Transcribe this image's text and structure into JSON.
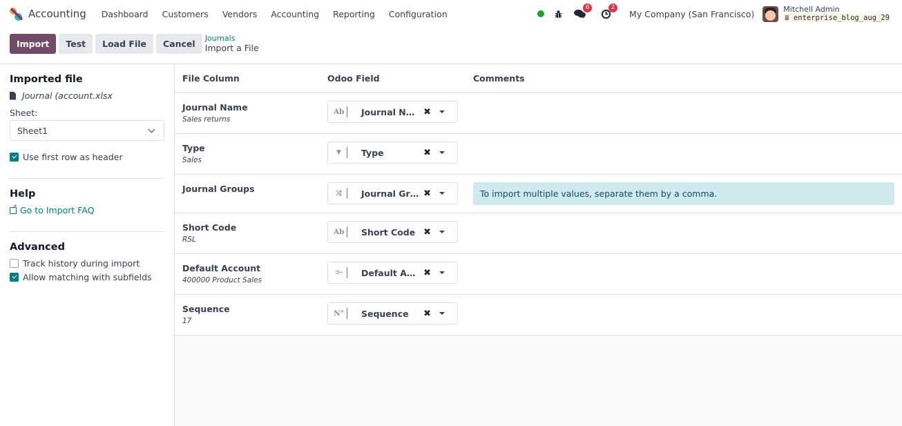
{
  "navbar": {
    "app_name": "Accounting",
    "menu": [
      "Dashboard",
      "Customers",
      "Vendors",
      "Accounting",
      "Reporting",
      "Configuration"
    ],
    "messages_count": "6",
    "activities_count": "2",
    "company": "My Company (San Francisco)",
    "user_name": "Mitchell Admin",
    "database": "enterprise_blog_aug_29",
    "status_color": "#17a52d"
  },
  "control": {
    "buttons": {
      "import": "Import",
      "test": "Test",
      "load_file": "Load File",
      "cancel": "Cancel"
    },
    "breadcrumb": {
      "parent": "Journals",
      "current": "Import a File"
    }
  },
  "sidebar": {
    "imported_file_title": "Imported file",
    "file_name": "Journal (account.xlsx",
    "sheet_label": "Sheet:",
    "sheet_value": "Sheet1",
    "use_first_row_label": "Use first row as header",
    "use_first_row_checked": true,
    "help_title": "Help",
    "help_link": "Go to Import FAQ",
    "advanced_title": "Advanced",
    "track_history_label": "Track history during import",
    "track_history_checked": false,
    "allow_matching_label": "Allow matching with subfields",
    "allow_matching_checked": true
  },
  "table": {
    "headers": {
      "file_column": "File Column",
      "odoo_field": "Odoo Field",
      "comments": "Comments"
    },
    "rows": [
      {
        "column": "Journal Name",
        "sample": "Sales returns",
        "type_icon": "Ab",
        "type_name": "char",
        "field": "Journal Name",
        "comment": ""
      },
      {
        "column": "Type",
        "sample": "Sales",
        "type_icon": "▼",
        "type_name": "selection",
        "field": "Type",
        "comment": ""
      },
      {
        "column": "Journal Groups",
        "sample": "",
        "type_icon": "⤨",
        "type_name": "many2many",
        "field": "Journal Gro...",
        "comment": "To import multiple values, separate them by a comma."
      },
      {
        "column": "Short Code",
        "sample": "RSL",
        "type_icon": "Ab",
        "type_name": "char",
        "field": "Short Code",
        "comment": ""
      },
      {
        "column": "Default Account",
        "sample": "400000 Product Sales",
        "type_icon": "⊃-",
        "type_name": "many2one",
        "field": "Default Acc...",
        "comment": ""
      },
      {
        "column": "Sequence",
        "sample": "17",
        "type_icon": "N°",
        "type_name": "integer",
        "field": "Sequence",
        "comment": ""
      }
    ]
  }
}
